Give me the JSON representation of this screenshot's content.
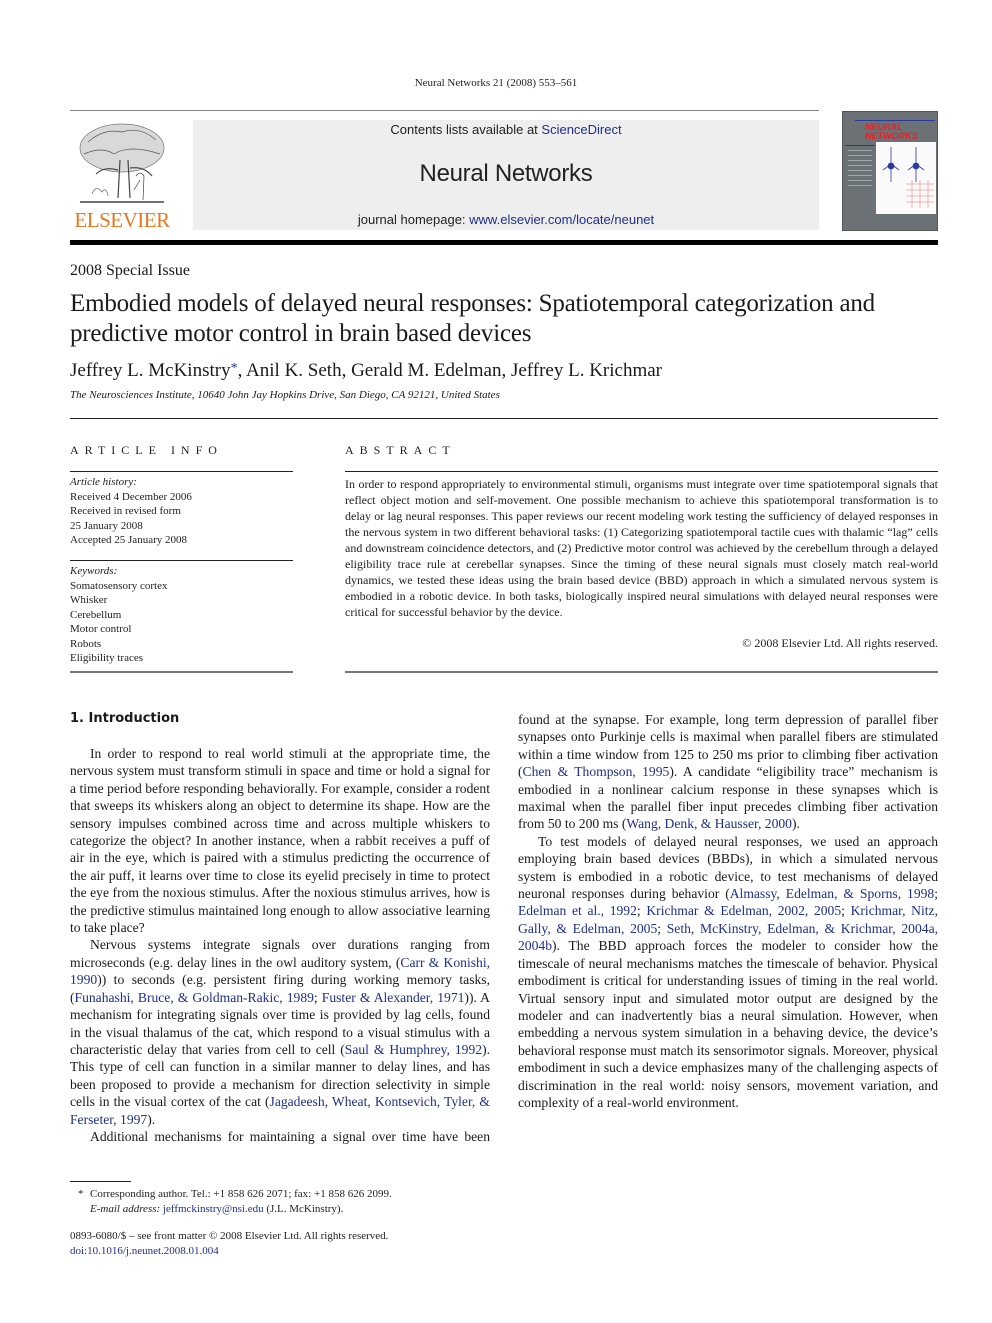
{
  "running_header": "Neural Networks 21 (2008) 553–561",
  "masthead": {
    "publisher_wordmark": "ELSEVIER",
    "contents_prefix": "Contents lists available at ",
    "contents_link": "ScienceDirect",
    "journal_name": "Neural Networks",
    "homepage_prefix": "journal homepage: ",
    "homepage_link": "www.elsevier.com/locate/neunet",
    "cover_title_line1": "NEURAL",
    "cover_title_line2": "NETWORKS",
    "colors": {
      "publisher_orange": "#e87722",
      "link_blue": "#1f2f8c",
      "box_gray": "#eeeeee",
      "cover_gray": "#6c7175",
      "cover_red": "#e0242a"
    }
  },
  "article": {
    "special_issue": "2008 Special Issue",
    "title": "Embodied models of delayed neural responses: Spatiotemporal categorization and predictive motor control in brain based devices",
    "authors": [
      {
        "name": "Jeffrey L. McKinstry",
        "corresponding": true
      },
      {
        "name": "Anil K. Seth",
        "corresponding": false
      },
      {
        "name": "Gerald M. Edelman",
        "corresponding": false
      },
      {
        "name": "Jeffrey L. Krichmar",
        "corresponding": false
      }
    ],
    "author_sep": ", ",
    "corresponding_mark": "*",
    "affiliation": "The Neurosciences Institute, 10640 John Jay Hopkins Drive, San Diego, CA 92121, United States"
  },
  "article_info": {
    "heading": "ARTICLE INFO",
    "history_label": "Article history:",
    "history": [
      "Received 4 December 2006",
      "Received in revised form",
      "25 January 2008",
      "Accepted 25 January 2008"
    ],
    "keywords_label": "Keywords:",
    "keywords": [
      "Somatosensory cortex",
      "Whisker",
      "Cerebellum",
      "Motor control",
      "Robots",
      "Eligibility traces"
    ]
  },
  "abstract": {
    "heading": "ABSTRACT",
    "text": "In order to respond appropriately to environmental stimuli, organisms must integrate over time spatiotemporal signals that reflect object motion and self-movement. One possible mechanism to achieve this spatiotemporal transformation is to delay or lag neural responses. This paper reviews our recent modeling work testing the sufficiency of delayed responses in the nervous system in two different behavioral tasks: (1) Categorizing spatiotemporal tactile cues with thalamic “lag” cells and downstream coincidence detectors, and (2) Predictive motor control was achieved by the cerebellum through a delayed eligibility trace rule at cerebellar synapses. Since the timing of these neural signals must closely match real-world dynamics, we tested these ideas using the brain based device (BBD) approach in which a simulated nervous system is embodied in a robotic device. In both tasks, biologically inspired neural simulations with delayed neural responses were critical for successful behavior by the device.",
    "copyright": "© 2008 Elsevier Ltd. All rights reserved."
  },
  "body": {
    "section_heading": "1.  Introduction",
    "paragraphs": [
      {
        "indent": true,
        "segments": [
          {
            "t": "In order to respond to real world stimuli at the appropriate time, the nervous system must transform stimuli in space and time or hold a signal for a time period before responding behaviorally. For example, consider a rodent that sweeps its whiskers along an object to determine its shape. How are the sensory impulses combined across time and across multiple whiskers to categorize the object? In another instance, when a rabbit receives a puff of air in the eye, which is paired with a stimulus predicting the occurrence of the air puff, it learns over time to close its eyelid precisely in time to protect the eye from the noxious stimulus. After the noxious stimulus arrives, how is the predictive stimulus maintained long enough to allow associative learning to take place?"
          }
        ]
      },
      {
        "indent": true,
        "segments": [
          {
            "t": "Nervous systems integrate signals over durations ranging from microseconds (e.g. delay lines in the owl auditory system, ("
          },
          {
            "t": "Carr & Konishi, 1990",
            "link": true
          },
          {
            "t": ")) to seconds (e.g. persistent firing during working memory tasks, ("
          },
          {
            "t": "Funahashi, Bruce, & Goldman-Rakic, 1989",
            "link": true
          },
          {
            "t": "; "
          },
          {
            "t": "Fuster & Alexander, 1971",
            "link": true
          },
          {
            "t": ")). A mechanism for integrating signals over time is provided by lag cells, found in the visual thalamus of the cat, which respond to a visual stimulus with a characteristic delay that varies from cell to cell ("
          },
          {
            "t": "Saul & Humphrey, 1992",
            "link": true
          },
          {
            "t": "). This type of cell can function in a similar manner to delay lines, and has been proposed to provide a mechanism for direction selectivity in simple cells in the visual cortex of the cat ("
          },
          {
            "t": "Jagadeesh, Wheat, Kontsevich, Tyler, & Ferseter, 1997",
            "link": true
          },
          {
            "t": ")."
          }
        ]
      },
      {
        "indent": true,
        "segments": [
          {
            "t": "Additional mechanisms for maintaining a signal over time have been found at the synapse. For example, long term depression of parallel fiber synapses onto Purkinje cells is maximal when parallel fibers are stimulated within a time window from 125 to 250 ms prior to climbing fiber activation ("
          },
          {
            "t": "Chen & Thompson, 1995",
            "link": true
          },
          {
            "t": "). A candidate “eligibility trace” mechanism is embodied in a nonlinear calcium response in these synapses which is maximal when the parallel fiber input precedes climbing fiber activation from 50 to 200 ms ("
          },
          {
            "t": "Wang, Denk, & Hausser, 2000",
            "link": true
          },
          {
            "t": ")."
          }
        ]
      },
      {
        "indent": true,
        "segments": [
          {
            "t": "To test models of delayed neural responses, we used an approach employing brain based devices (BBDs), in which a simulated nervous system is embodied in a robotic device, to test mechanisms of delayed neuronal responses during behavior ("
          },
          {
            "t": "Almassy, Edelman, & Sporns, 1998",
            "link": true
          },
          {
            "t": "; "
          },
          {
            "t": "Edelman et al., 1992",
            "link": true
          },
          {
            "t": "; "
          },
          {
            "t": "Krichmar & Edelman, 2002, 2005",
            "link": true
          },
          {
            "t": "; "
          },
          {
            "t": "Krichmar, Nitz, Gally, & Edelman, 2005",
            "link": true
          },
          {
            "t": "; "
          },
          {
            "t": "Seth, McKinstry, Edelman, & Krichmar, 2004a, 2004b",
            "link": true
          },
          {
            "t": "). The BBD approach forces the modeler to consider how the timescale of neural mechanisms matches the timescale of behavior. Physical embodiment is critical for understanding issues of timing in the real world. Virtual sensory input and simulated motor output are designed by the modeler and can inadvertently bias a neural simulation. However, when embedding a nervous system simulation in a behaving device, the device’s behavioral response must match its sensorimotor signals. Moreover, physical embodiment in such a device emphasizes many of the challenging aspects of discrimination in the real world: noisy sensors, movement variation, and complexity of a real-world environment."
          }
        ]
      }
    ]
  },
  "footnotes": {
    "asterisk": "*",
    "corresponding_text": "Corresponding author. Tel.: +1 858 626 2071; fax: +1 858 626 2099.",
    "email_label": "E-mail address:",
    "email": "jeffmckinstry@nsi.edu",
    "email_suffix": " (J.L. McKinstry).",
    "front_matter": "0893-6080/$ – see front matter © 2008 Elsevier Ltd. All rights reserved.",
    "doi": "doi:10.1016/j.neunet.2008.01.004"
  }
}
